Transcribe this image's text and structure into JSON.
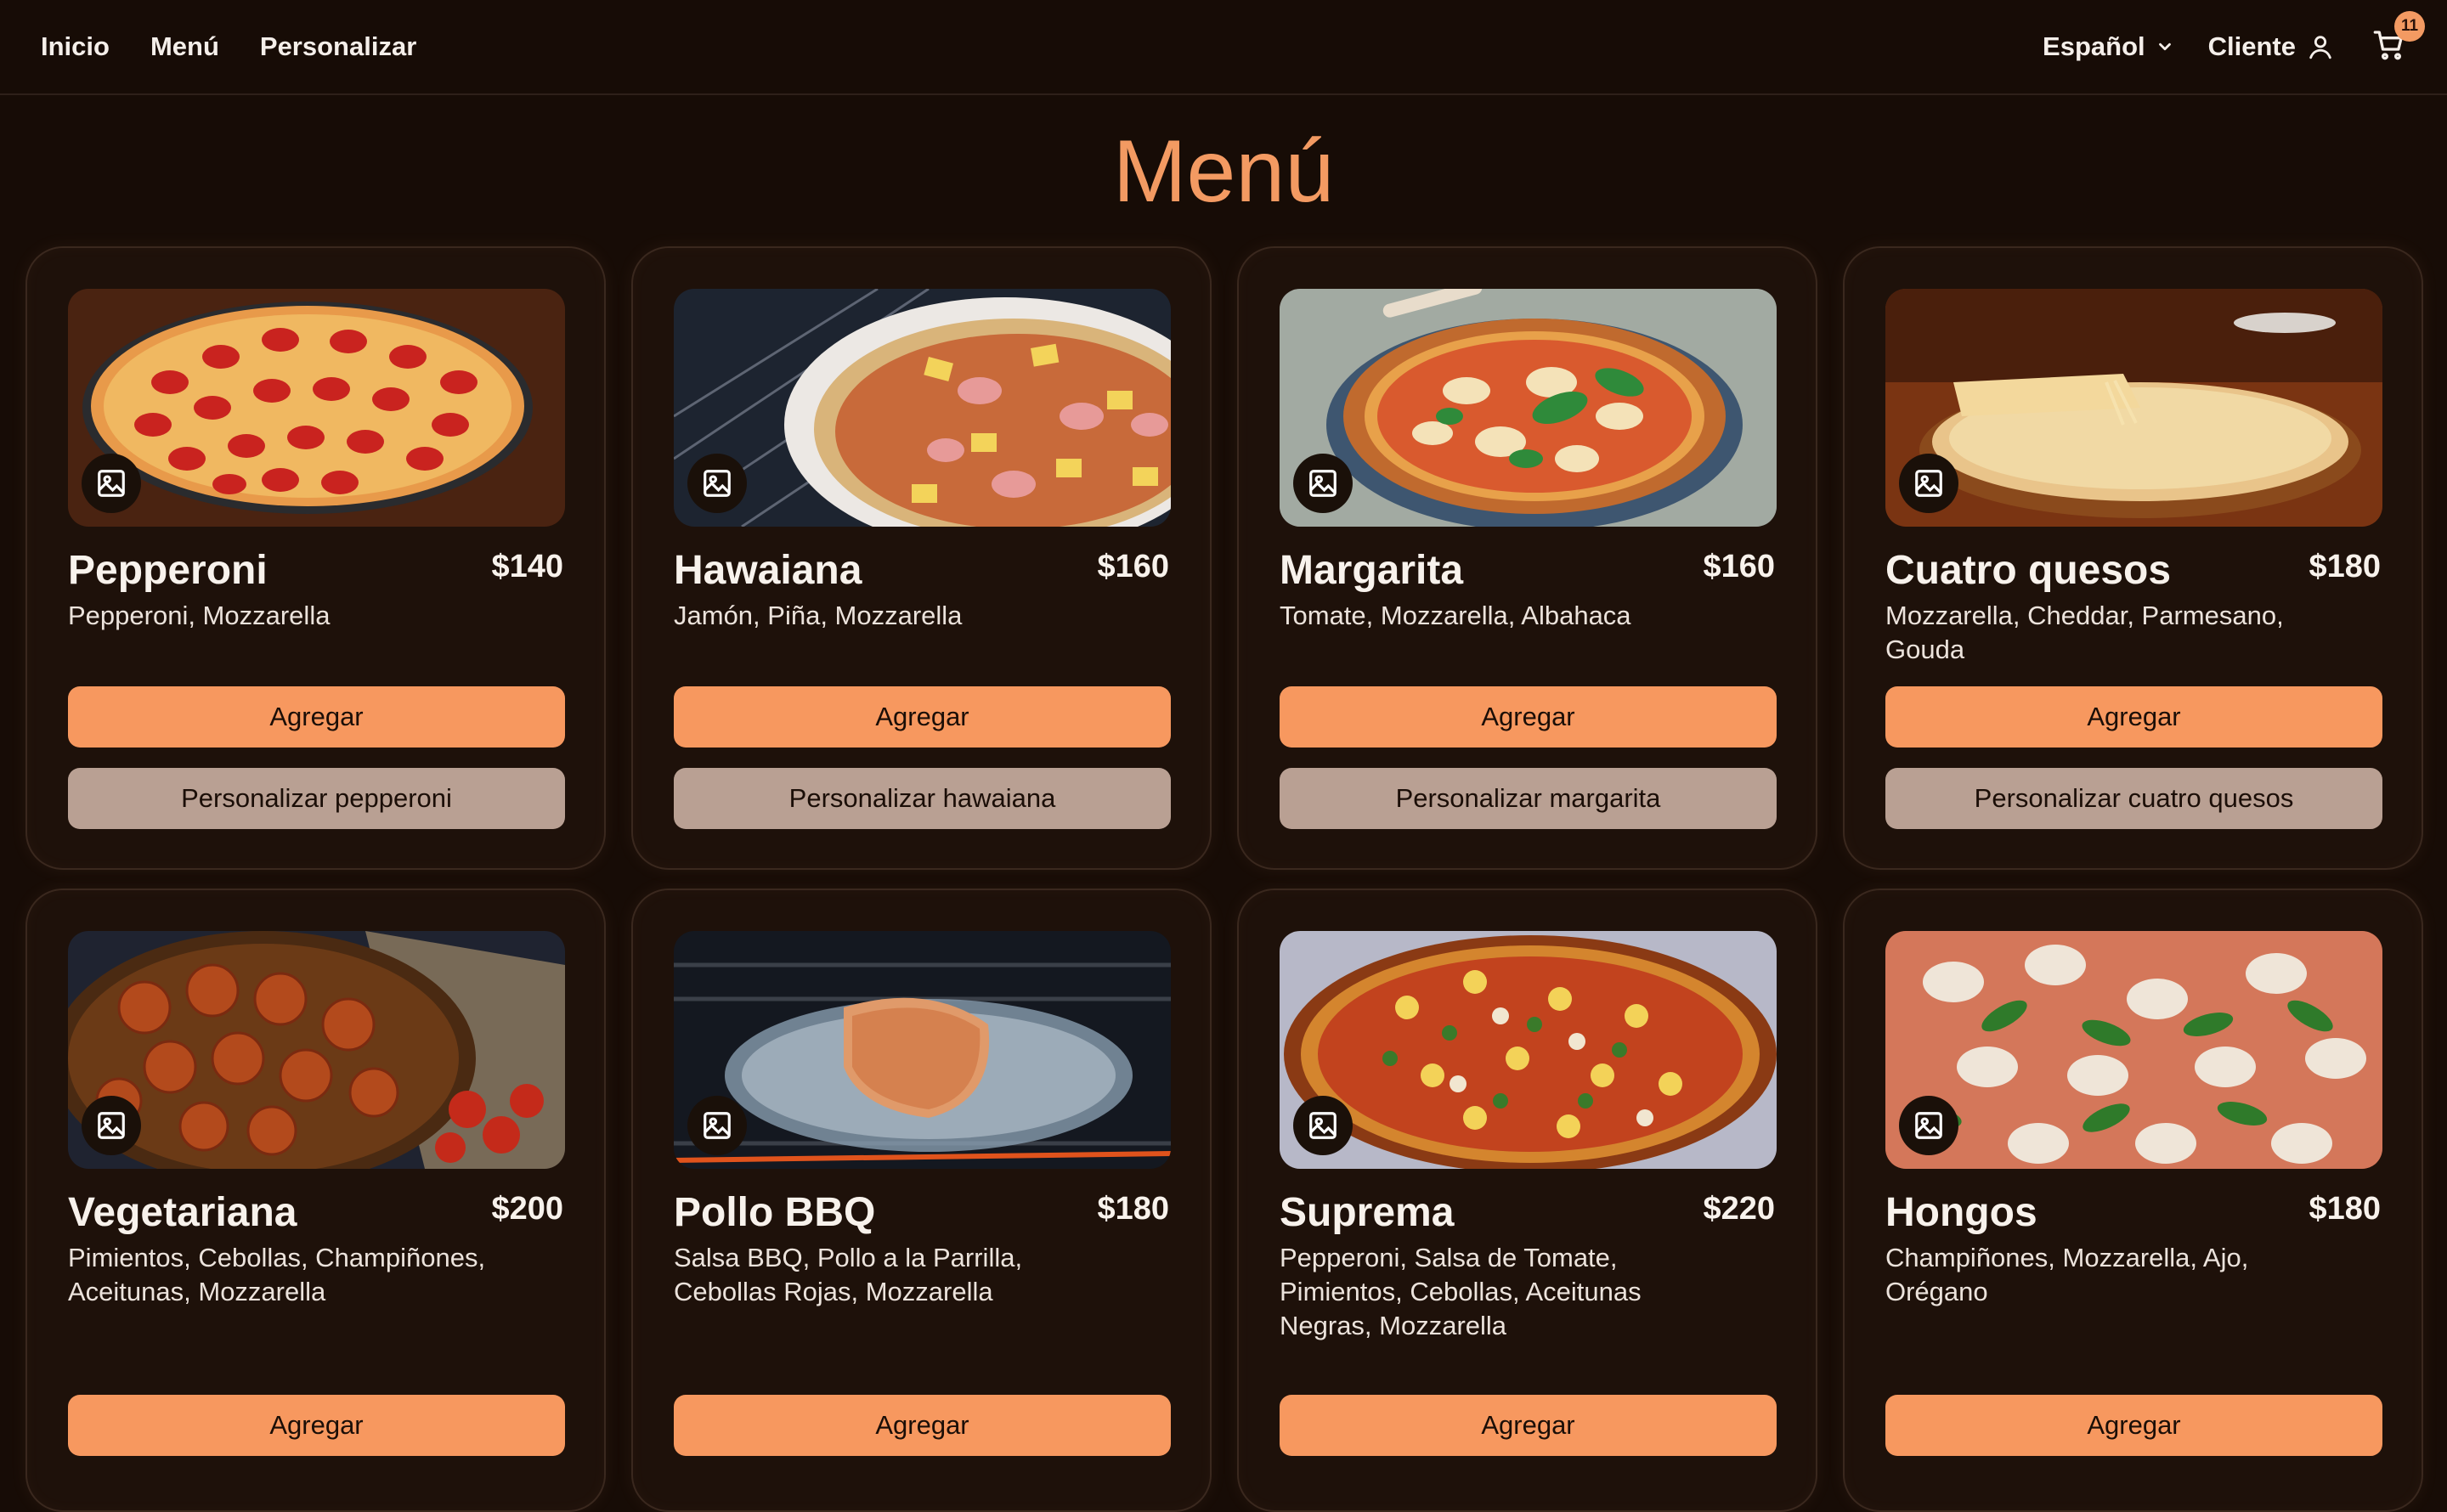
{
  "nav": {
    "links": [
      "Inicio",
      "Menú",
      "Personalizar"
    ],
    "language": "Español",
    "account": "Cliente",
    "cart_count": "11"
  },
  "title": "Menú",
  "pizzas": [
    {
      "name": "Pepperoni",
      "price": "$140",
      "ingredients": "Pepperoni, Mozzarella",
      "add": "Agregar",
      "customize": "Personalizar pepperoni"
    },
    {
      "name": "Hawaiana",
      "price": "$160",
      "ingredients": "Jamón, Piña, Mozzarella",
      "add": "Agregar",
      "customize": "Personalizar hawaiana"
    },
    {
      "name": "Margarita",
      "price": "$160",
      "ingredients": "Tomate, Mozzarella, Albahaca",
      "add": "Agregar",
      "customize": "Personalizar margarita"
    },
    {
      "name": "Cuatro quesos",
      "price": "$180",
      "ingredients": "Mozzarella, Cheddar, Parmesano, Gouda",
      "add": "Agregar",
      "customize": "Personalizar cuatro quesos"
    },
    {
      "name": "Vegetariana",
      "price": "$200",
      "ingredients": "Pimientos, Cebollas, Champiñones, Aceitunas, Mozzarella",
      "add": "Agregar"
    },
    {
      "name": "Pollo BBQ",
      "price": "$180",
      "ingredients": "Salsa BBQ, Pollo a la Parrilla, Cebollas Rojas, Mozzarella",
      "add": "Agregar"
    },
    {
      "name": "Suprema",
      "price": "$220",
      "ingredients": "Pepperoni, Salsa de Tomate, Pimientos, Cebollas, Aceitunas Negras, Mozzarella",
      "add": "Agregar"
    },
    {
      "name": "Hongos",
      "price": "$180",
      "ingredients": "Champiñones, Mozzarella, Ajo, Orégano",
      "add": "Agregar"
    }
  ],
  "colors": {
    "background": "#170c06",
    "accent": "#f39a62",
    "add_button": "#f7985f",
    "customize_button": "#b9a093"
  }
}
